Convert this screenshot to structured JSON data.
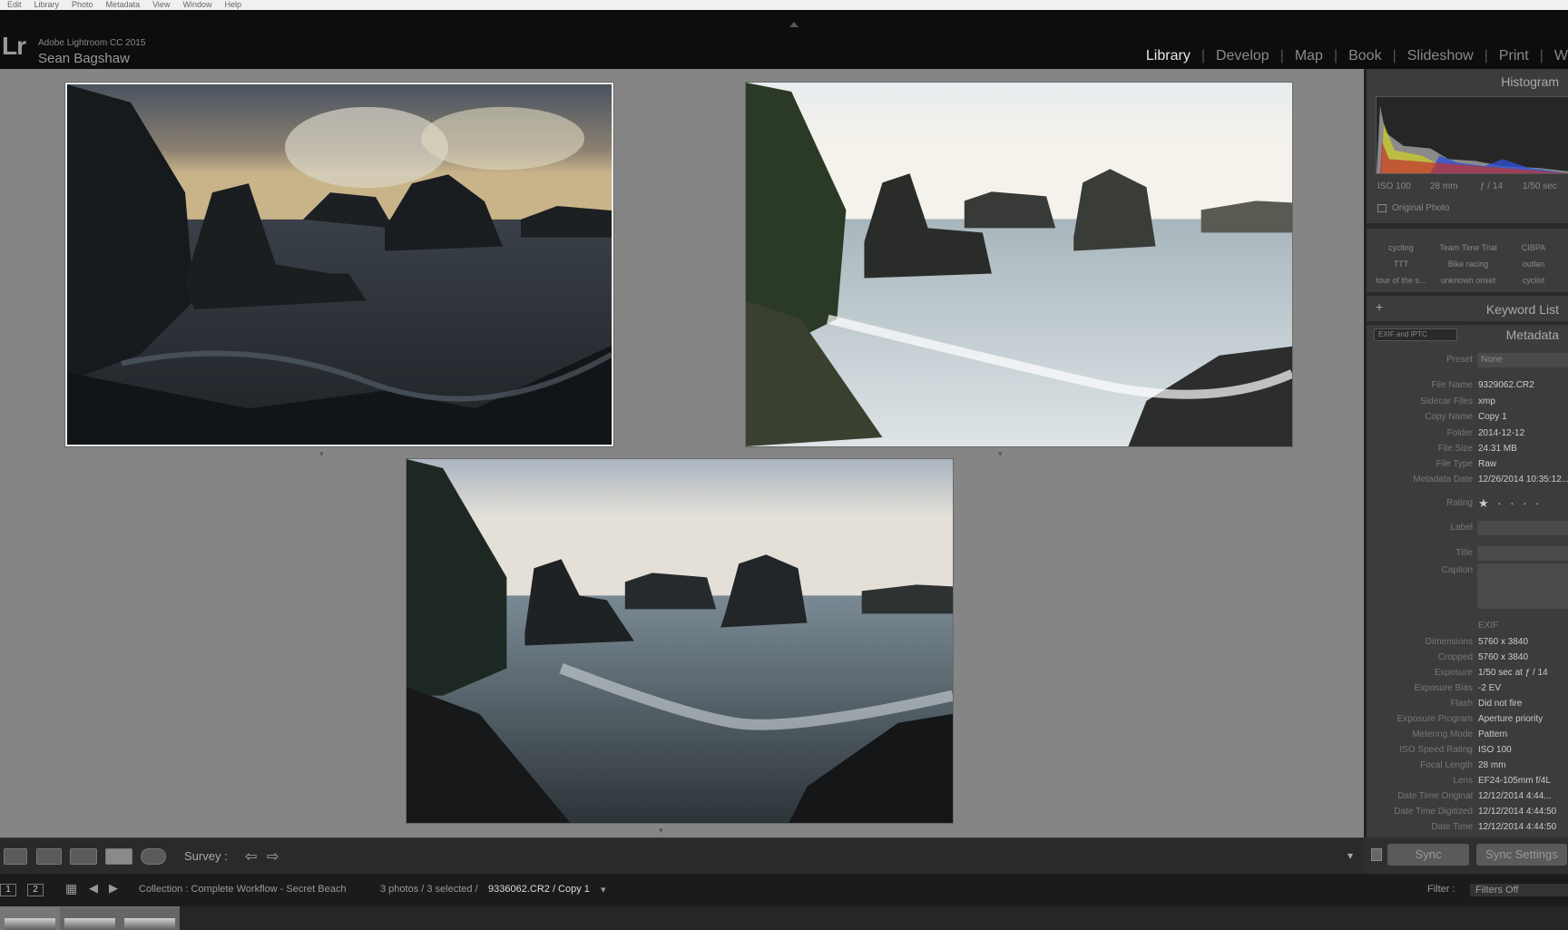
{
  "menu": [
    "Edit",
    "Library",
    "Photo",
    "Metadata",
    "View",
    "Window",
    "Help"
  ],
  "app": {
    "logo": "Lr",
    "name": "Adobe Lightroom CC 2015",
    "user": "Sean Bagshaw"
  },
  "modules": [
    "Library",
    "Develop",
    "Map",
    "Book",
    "Slideshow",
    "Print",
    "W"
  ],
  "active_module": "Library",
  "toolbar": {
    "survey_label": "Survey :",
    "back": "⇦",
    "fwd": "⇨",
    "menu": "▾"
  },
  "filmstrip": {
    "page1": "1",
    "page2": "2",
    "collection": "Collection : Complete Workflow - Secret Beach",
    "count": "3 photos / 3 selected /",
    "file": "9336062.CR2 / Copy 1",
    "filter_label": "Filter :",
    "filter_value": "Filters Off"
  },
  "histogram": {
    "title": "Histogram",
    "iso": "ISO 100",
    "focal": "28 mm",
    "aperture": "ƒ / 14",
    "shutter": "1/50 sec",
    "original": "Original Photo"
  },
  "keywords": [
    [
      "cycling",
      "Team Time Trial",
      "CIBPA"
    ],
    [
      "TTT",
      "Bike racing",
      "outlan"
    ],
    [
      "tour of the s...",
      "unknown onset",
      "cyclist"
    ]
  ],
  "keyword_list_label": "Keyword List",
  "keyword_add": "+",
  "metadata": {
    "title": "Metadata",
    "preset_selector": "EXIF and IPTC",
    "preset_label": "Preset",
    "preset_value": "None",
    "fields": [
      [
        "File Name",
        "9329062.CR2"
      ],
      [
        "Sidecar Files",
        "xmp"
      ],
      [
        "Copy Name",
        "Copy 1"
      ],
      [
        "Folder",
        "2014-12-12"
      ],
      [
        "File Size",
        "24.31 MB"
      ],
      [
        "File Type",
        "Raw"
      ],
      [
        "Metadata Date",
        "12/26/2014 10:35:12..."
      ]
    ],
    "rating_label": "Rating",
    "rating_value": "★ · · · ·",
    "label_label": "Label",
    "title_label": "Title",
    "caption_label": "Caption",
    "exif_label": "EXIF",
    "exif": [
      [
        "Dimensions",
        "5760 x 3840"
      ],
      [
        "Cropped",
        "5760 x 3840"
      ],
      [
        "Exposure",
        "1/50 sec at ƒ / 14"
      ],
      [
        "Exposure Bias",
        "-2 EV"
      ],
      [
        "Flash",
        "Did not fire"
      ],
      [
        "Exposure Program",
        "Aperture priority"
      ],
      [
        "Metering Mode",
        "Pattern"
      ],
      [
        "ISO Speed Rating",
        "ISO 100"
      ],
      [
        "Focal Length",
        "28 mm"
      ],
      [
        "Lens",
        "EF24-105mm f/4L"
      ],
      [
        "Date Time Original",
        "12/12/2014 4:44..."
      ],
      [
        "Date Time Digitized",
        "12/12/2014 4:44:50"
      ],
      [
        "Date Time",
        "12/12/2014 4:44:50"
      ]
    ]
  },
  "sync": {
    "sync": "Sync",
    "sync_settings": "Sync Settings"
  },
  "colors": {
    "accent": "#e6e6e6",
    "panel": "#3c3c3c",
    "center": "#858585"
  }
}
